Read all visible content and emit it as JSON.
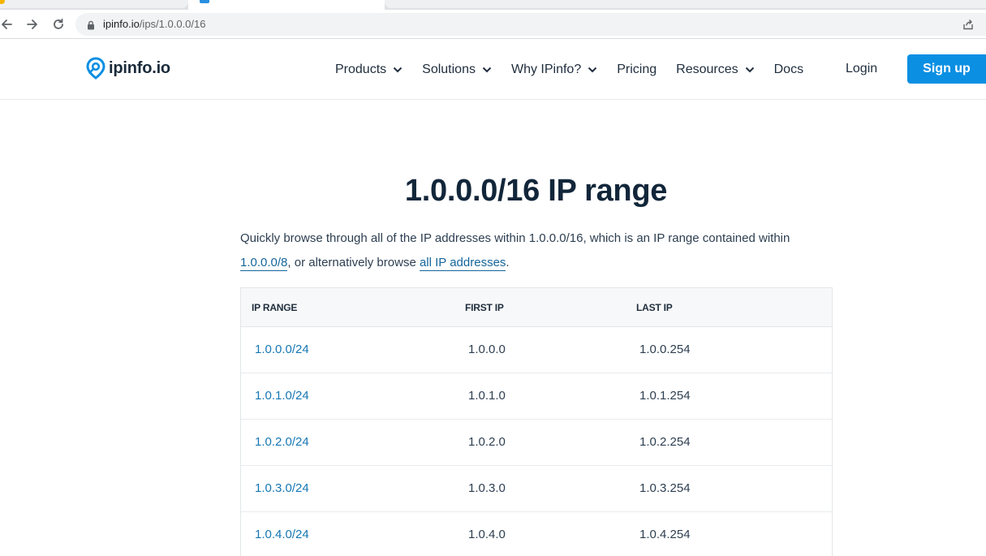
{
  "browser": {
    "url_host": "ipinfo.io",
    "url_path": "/ips/1.0.0.0/16"
  },
  "header": {
    "logo_text": "ipinfo.io",
    "menu": [
      {
        "label": "Products",
        "has_dropdown": true
      },
      {
        "label": "Solutions",
        "has_dropdown": true
      },
      {
        "label": "Why IPinfo?",
        "has_dropdown": true
      },
      {
        "label": "Pricing",
        "has_dropdown": false
      },
      {
        "label": "Resources",
        "has_dropdown": true
      },
      {
        "label": "Docs",
        "has_dropdown": false
      }
    ],
    "login_label": "Login",
    "signup_label": "Sign up"
  },
  "main": {
    "title": "1.0.0.0/16 IP range",
    "intro_prefix": "Quickly browse through all of the IP addresses within 1.0.0.0/16, which is an IP range contained within ",
    "intro_link1": "1.0.0.0/8",
    "intro_middle": ", or alternatively browse ",
    "intro_link2": "all IP addresses",
    "intro_suffix": "."
  },
  "table": {
    "columns": [
      "IP RANGE",
      "FIRST IP",
      "LAST IP"
    ],
    "rows": [
      [
        "1.0.0.0/24",
        "1.0.0.0",
        "1.0.0.254"
      ],
      [
        "1.0.1.0/24",
        "1.0.1.0",
        "1.0.1.254"
      ],
      [
        "1.0.2.0/24",
        "1.0.2.0",
        "1.0.2.254"
      ],
      [
        "1.0.3.0/24",
        "1.0.3.0",
        "1.0.3.254"
      ],
      [
        "1.0.4.0/24",
        "1.0.4.0",
        "1.0.4.254"
      ]
    ]
  },
  "colors": {
    "accent": "#0a8fe3",
    "link": "#1577b4",
    "heading": "#12263a"
  }
}
